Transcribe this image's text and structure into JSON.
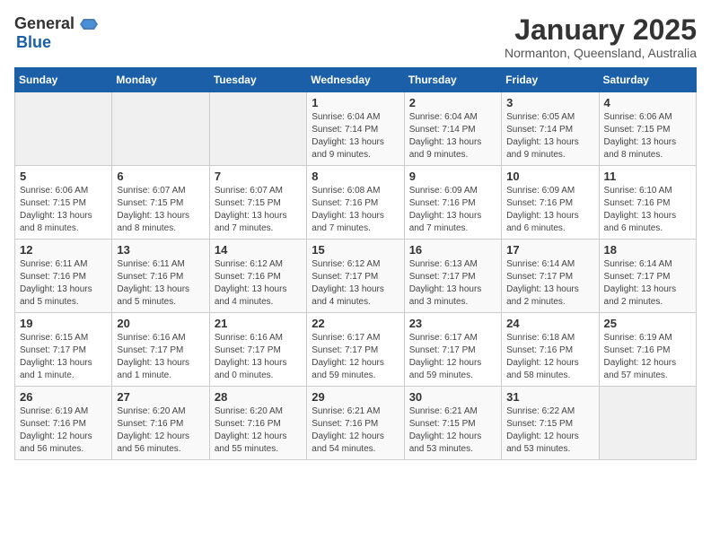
{
  "logo": {
    "general": "General",
    "blue": "Blue"
  },
  "header": {
    "month": "January 2025",
    "location": "Normanton, Queensland, Australia"
  },
  "days_of_week": [
    "Sunday",
    "Monday",
    "Tuesday",
    "Wednesday",
    "Thursday",
    "Friday",
    "Saturday"
  ],
  "weeks": [
    [
      {
        "day": "",
        "info": ""
      },
      {
        "day": "",
        "info": ""
      },
      {
        "day": "",
        "info": ""
      },
      {
        "day": "1",
        "info": "Sunrise: 6:04 AM\nSunset: 7:14 PM\nDaylight: 13 hours\nand 9 minutes."
      },
      {
        "day": "2",
        "info": "Sunrise: 6:04 AM\nSunset: 7:14 PM\nDaylight: 13 hours\nand 9 minutes."
      },
      {
        "day": "3",
        "info": "Sunrise: 6:05 AM\nSunset: 7:14 PM\nDaylight: 13 hours\nand 9 minutes."
      },
      {
        "day": "4",
        "info": "Sunrise: 6:06 AM\nSunset: 7:15 PM\nDaylight: 13 hours\nand 8 minutes."
      }
    ],
    [
      {
        "day": "5",
        "info": "Sunrise: 6:06 AM\nSunset: 7:15 PM\nDaylight: 13 hours\nand 8 minutes."
      },
      {
        "day": "6",
        "info": "Sunrise: 6:07 AM\nSunset: 7:15 PM\nDaylight: 13 hours\nand 8 minutes."
      },
      {
        "day": "7",
        "info": "Sunrise: 6:07 AM\nSunset: 7:15 PM\nDaylight: 13 hours\nand 7 minutes."
      },
      {
        "day": "8",
        "info": "Sunrise: 6:08 AM\nSunset: 7:16 PM\nDaylight: 13 hours\nand 7 minutes."
      },
      {
        "day": "9",
        "info": "Sunrise: 6:09 AM\nSunset: 7:16 PM\nDaylight: 13 hours\nand 7 minutes."
      },
      {
        "day": "10",
        "info": "Sunrise: 6:09 AM\nSunset: 7:16 PM\nDaylight: 13 hours\nand 6 minutes."
      },
      {
        "day": "11",
        "info": "Sunrise: 6:10 AM\nSunset: 7:16 PM\nDaylight: 13 hours\nand 6 minutes."
      }
    ],
    [
      {
        "day": "12",
        "info": "Sunrise: 6:11 AM\nSunset: 7:16 PM\nDaylight: 13 hours\nand 5 minutes."
      },
      {
        "day": "13",
        "info": "Sunrise: 6:11 AM\nSunset: 7:16 PM\nDaylight: 13 hours\nand 5 minutes."
      },
      {
        "day": "14",
        "info": "Sunrise: 6:12 AM\nSunset: 7:16 PM\nDaylight: 13 hours\nand 4 minutes."
      },
      {
        "day": "15",
        "info": "Sunrise: 6:12 AM\nSunset: 7:17 PM\nDaylight: 13 hours\nand 4 minutes."
      },
      {
        "day": "16",
        "info": "Sunrise: 6:13 AM\nSunset: 7:17 PM\nDaylight: 13 hours\nand 3 minutes."
      },
      {
        "day": "17",
        "info": "Sunrise: 6:14 AM\nSunset: 7:17 PM\nDaylight: 13 hours\nand 2 minutes."
      },
      {
        "day": "18",
        "info": "Sunrise: 6:14 AM\nSunset: 7:17 PM\nDaylight: 13 hours\nand 2 minutes."
      }
    ],
    [
      {
        "day": "19",
        "info": "Sunrise: 6:15 AM\nSunset: 7:17 PM\nDaylight: 13 hours\nand 1 minute."
      },
      {
        "day": "20",
        "info": "Sunrise: 6:16 AM\nSunset: 7:17 PM\nDaylight: 13 hours\nand 1 minute."
      },
      {
        "day": "21",
        "info": "Sunrise: 6:16 AM\nSunset: 7:17 PM\nDaylight: 13 hours\nand 0 minutes."
      },
      {
        "day": "22",
        "info": "Sunrise: 6:17 AM\nSunset: 7:17 PM\nDaylight: 12 hours\nand 59 minutes."
      },
      {
        "day": "23",
        "info": "Sunrise: 6:17 AM\nSunset: 7:17 PM\nDaylight: 12 hours\nand 59 minutes."
      },
      {
        "day": "24",
        "info": "Sunrise: 6:18 AM\nSunset: 7:16 PM\nDaylight: 12 hours\nand 58 minutes."
      },
      {
        "day": "25",
        "info": "Sunrise: 6:19 AM\nSunset: 7:16 PM\nDaylight: 12 hours\nand 57 minutes."
      }
    ],
    [
      {
        "day": "26",
        "info": "Sunrise: 6:19 AM\nSunset: 7:16 PM\nDaylight: 12 hours\nand 56 minutes."
      },
      {
        "day": "27",
        "info": "Sunrise: 6:20 AM\nSunset: 7:16 PM\nDaylight: 12 hours\nand 56 minutes."
      },
      {
        "day": "28",
        "info": "Sunrise: 6:20 AM\nSunset: 7:16 PM\nDaylight: 12 hours\nand 55 minutes."
      },
      {
        "day": "29",
        "info": "Sunrise: 6:21 AM\nSunset: 7:16 PM\nDaylight: 12 hours\nand 54 minutes."
      },
      {
        "day": "30",
        "info": "Sunrise: 6:21 AM\nSunset: 7:15 PM\nDaylight: 12 hours\nand 53 minutes."
      },
      {
        "day": "31",
        "info": "Sunrise: 6:22 AM\nSunset: 7:15 PM\nDaylight: 12 hours\nand 53 minutes."
      },
      {
        "day": "",
        "info": ""
      }
    ]
  ]
}
